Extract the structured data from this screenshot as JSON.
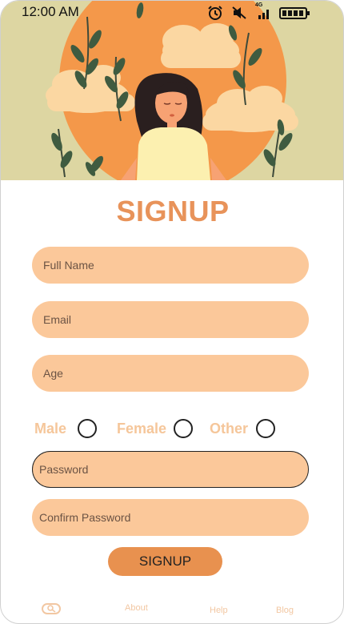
{
  "status_bar": {
    "time": "12:00 AM",
    "network_label": "4G"
  },
  "title": "SIGNUP",
  "form": {
    "full_name_placeholder": "Full Name",
    "email_placeholder": "Email",
    "age_placeholder": "Age",
    "gender_options": [
      "Male",
      "Female",
      "Other"
    ],
    "password_placeholder": "Password",
    "confirm_password_placeholder": "Confirm Password",
    "submit_label": "SIGNUP"
  },
  "nav": {
    "items": [
      "About",
      "Help",
      "Blog"
    ]
  },
  "colors": {
    "accent": "#e8935a",
    "field_bg": "#fbc89a",
    "button_bg": "#e8914f",
    "hero_bg": "#ddd6a2",
    "sun": "#f4984a"
  }
}
